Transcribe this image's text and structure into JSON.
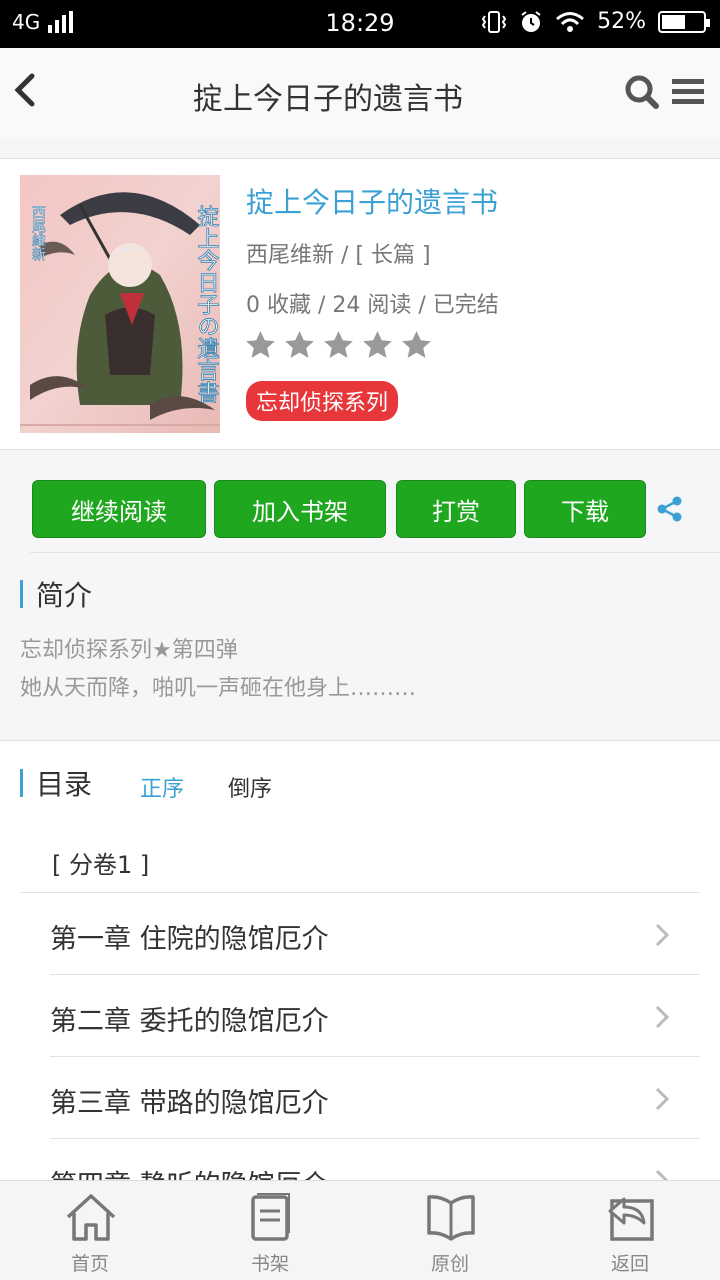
{
  "status_bar": {
    "network": "4G",
    "time": "18:29",
    "battery": "52%"
  },
  "header": {
    "title": "掟上今日子的遗言书"
  },
  "book": {
    "title": "掟上今日子的遗言书",
    "author_line": "西尾维新 / [ 长篇 ]",
    "stats_line": "0 收藏 / 24 阅读 / 已完结",
    "rating": 0,
    "tag": "忘却侦探系列",
    "cover_title": "掟上今日子の遺言書",
    "cover_author": "西尾維新"
  },
  "actions": {
    "continue": "继续阅读",
    "add_shelf": "加入书架",
    "reward": "打赏",
    "download": "下载"
  },
  "intro": {
    "title": "简介",
    "line1": "忘却侦探系列★第四弹",
    "line2": "她从天而降，啪叽一声砸在他身上………"
  },
  "toc": {
    "title": "目录",
    "asc": "正序",
    "desc": "倒序",
    "volume": "[ 分卷1 ]",
    "chapters": [
      "第一章 住院的隐馆厄介",
      "第二章 委托的隐馆厄介",
      "第三章 带路的隐馆厄介",
      "第四章 静听的隐馆厄介"
    ]
  },
  "nav": {
    "home": "首页",
    "shelf": "书架",
    "original": "原创",
    "back": "返回"
  },
  "colors": {
    "accent": "#3ba0d4",
    "green": "#1fa71f",
    "tag_red": "#e8373b"
  }
}
